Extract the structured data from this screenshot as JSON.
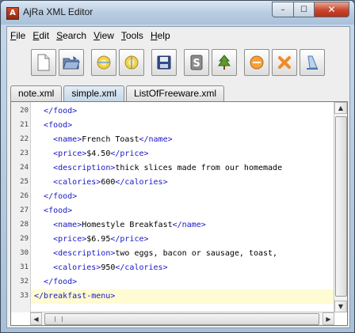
{
  "window": {
    "title": "AjRa XML Editor",
    "app_icon_letter": "A",
    "buttons": {
      "minimize": "–",
      "maximize": "☐",
      "close": "✕"
    }
  },
  "menu": [
    "File",
    "Edit",
    "Search",
    "View",
    "Tools",
    "Help"
  ],
  "toolbar": {
    "buttons": [
      "new-document-icon",
      "open-folder-icon",
      "globe-icon",
      "globe-alt-icon",
      "save-floppy-icon",
      "s-icon",
      "tree-icon",
      "validate-icon",
      "close-x-icon",
      "wizard-icon"
    ]
  },
  "tabs": [
    {
      "label": "note.xml",
      "active": false
    },
    {
      "label": "simple.xml",
      "active": true
    },
    {
      "label": "ListOfFreeware.xml",
      "active": false
    }
  ],
  "editor": {
    "lines": [
      {
        "num": "20",
        "indent": "  ",
        "segments": [
          {
            "t": "tag",
            "v": "</food>"
          }
        ]
      },
      {
        "num": "21",
        "indent": "  ",
        "segments": [
          {
            "t": "tag",
            "v": "<food>"
          }
        ]
      },
      {
        "num": "22",
        "indent": "    ",
        "segments": [
          {
            "t": "tag",
            "v": "<name>"
          },
          {
            "t": "tok",
            "v": "French Toast"
          },
          {
            "t": "tag",
            "v": "</name>"
          }
        ]
      },
      {
        "num": "23",
        "indent": "    ",
        "segments": [
          {
            "t": "tag",
            "v": "<price>"
          },
          {
            "t": "tok",
            "v": "$4.50"
          },
          {
            "t": "tag",
            "v": "</price>"
          }
        ]
      },
      {
        "num": "24",
        "indent": "    ",
        "segments": [
          {
            "t": "tag",
            "v": "<description>"
          },
          {
            "t": "tok",
            "v": "thick slices made from our homemade"
          }
        ]
      },
      {
        "num": "25",
        "indent": "    ",
        "segments": [
          {
            "t": "tag",
            "v": "<calories>"
          },
          {
            "t": "tok",
            "v": "600"
          },
          {
            "t": "tag",
            "v": "</calories>"
          }
        ]
      },
      {
        "num": "26",
        "indent": "  ",
        "segments": [
          {
            "t": "tag",
            "v": "</food>"
          }
        ]
      },
      {
        "num": "27",
        "indent": "  ",
        "segments": [
          {
            "t": "tag",
            "v": "<food>"
          }
        ]
      },
      {
        "num": "28",
        "indent": "    ",
        "segments": [
          {
            "t": "tag",
            "v": "<name>"
          },
          {
            "t": "tok",
            "v": "Homestyle Breakfast"
          },
          {
            "t": "tag",
            "v": "</name>"
          }
        ]
      },
      {
        "num": "29",
        "indent": "    ",
        "segments": [
          {
            "t": "tag",
            "v": "<price>"
          },
          {
            "t": "tok",
            "v": "$6.95"
          },
          {
            "t": "tag",
            "v": "</price>"
          }
        ]
      },
      {
        "num": "30",
        "indent": "    ",
        "segments": [
          {
            "t": "tag",
            "v": "<description>"
          },
          {
            "t": "tok",
            "v": "two eggs, bacon or sausage, toast,"
          }
        ]
      },
      {
        "num": "31",
        "indent": "    ",
        "segments": [
          {
            "t": "tag",
            "v": "<calories>"
          },
          {
            "t": "tok",
            "v": "950"
          },
          {
            "t": "tag",
            "v": "</calories>"
          }
        ]
      },
      {
        "num": "32",
        "indent": "  ",
        "segments": [
          {
            "t": "tag",
            "v": "</food>"
          }
        ]
      },
      {
        "num": "33",
        "indent": "",
        "segments": [
          {
            "t": "tag",
            "v": "</breakfast-menu>"
          }
        ]
      }
    ],
    "current_line": "33"
  },
  "colors": {
    "tag": "#1717c7",
    "text": "#000000",
    "current_line_bg": "#fffbd2"
  },
  "scroll": {
    "up": "▲",
    "down": "▼",
    "left": "◀",
    "right": "▶"
  }
}
